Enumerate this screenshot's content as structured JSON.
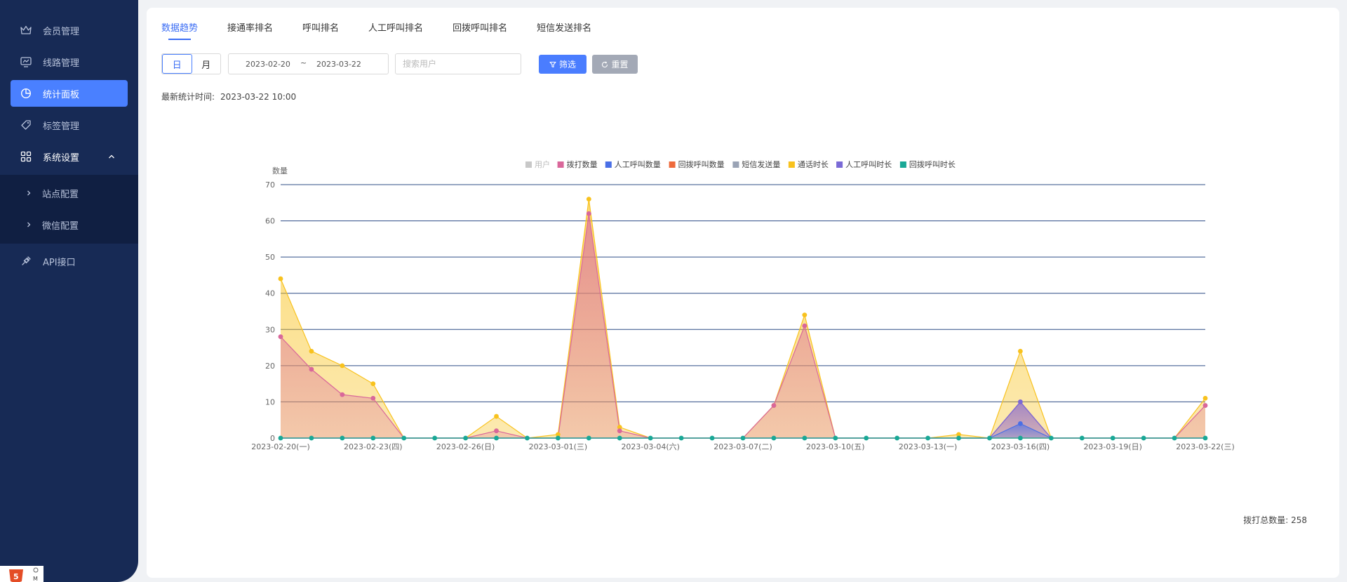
{
  "sidebar": {
    "items": [
      {
        "label": "会员管理",
        "icon": "crown-icon"
      },
      {
        "label": "线路管理",
        "icon": "route-icon"
      },
      {
        "label": "统计面板",
        "icon": "pie-chart-icon",
        "active": true
      },
      {
        "label": "标签管理",
        "icon": "tag-icon"
      },
      {
        "label": "系统设置",
        "icon": "grid-icon",
        "expanded": true
      },
      {
        "label": "API接口",
        "icon": "plug-icon"
      }
    ],
    "submenu": [
      {
        "label": "站点配置"
      },
      {
        "label": "微信配置"
      }
    ]
  },
  "tabs": [
    {
      "label": "数据趋势",
      "active": true
    },
    {
      "label": "接通率排名"
    },
    {
      "label": "呼叫排名"
    },
    {
      "label": "人工呼叫排名"
    },
    {
      "label": "回拨呼叫排名"
    },
    {
      "label": "短信发送排名"
    }
  ],
  "toolbar": {
    "seg_day": "日",
    "seg_month": "月",
    "date_start": "2023-02-20",
    "date_sep": "~",
    "date_end": "2023-03-22",
    "search_placeholder": "搜索用户",
    "filter_label": "筛选",
    "reset_label": "重置"
  },
  "stat_time": {
    "label": "最新统计时间:",
    "value": "2023-03-22 10:00"
  },
  "total": "拨打总数量: 258",
  "colors": {
    "accent": "#4a80ff",
    "sidebar_bg": "#172a55"
  },
  "chart_data": {
    "type": "area",
    "ylabel": "数量",
    "ylim": [
      0,
      70
    ],
    "yticks": [
      0,
      10,
      20,
      30,
      40,
      50,
      60,
      70
    ],
    "grid": true,
    "legend_position": "top",
    "x": [
      "2023-02-20(一)",
      "2023-02-21(二)",
      "2023-02-22(三)",
      "2023-02-23(四)",
      "2023-02-24(五)",
      "2023-02-25(六)",
      "2023-02-26(日)",
      "2023-02-27(一)",
      "2023-02-28(二)",
      "2023-03-01(三)",
      "2023-03-02(四)",
      "2023-03-03(五)",
      "2023-03-04(六)",
      "2023-03-05(日)",
      "2023-03-06(一)",
      "2023-03-07(二)",
      "2023-03-08(三)",
      "2023-03-09(四)",
      "2023-03-10(五)",
      "2023-03-11(六)",
      "2023-03-12(日)",
      "2023-03-13(一)",
      "2023-03-14(二)",
      "2023-03-15(三)",
      "2023-03-16(四)",
      "2023-03-17(五)",
      "2023-03-18(六)",
      "2023-03-19(日)",
      "2023-03-20(一)",
      "2023-03-21(二)",
      "2023-03-22(三)"
    ],
    "xtick_labels": [
      "2023-02-20(一)",
      "2023-02-23(四)",
      "2023-02-26(日)",
      "2023-03-01(三)",
      "2023-03-04(六)",
      "2023-03-07(二)",
      "2023-03-10(五)",
      "2023-03-13(一)",
      "2023-03-16(四)",
      "2023-03-19(日)",
      "2023-03-22(三)"
    ],
    "series": [
      {
        "name": "用户",
        "color": "#c8c8c8",
        "disabled": true,
        "values": []
      },
      {
        "name": "拨打数量",
        "color": "#d9679a",
        "values": [
          28,
          19,
          12,
          11,
          0,
          0,
          0,
          2,
          0,
          0,
          62,
          2,
          0,
          0,
          0,
          0,
          9,
          31,
          0,
          0,
          0,
          0,
          0,
          0,
          10,
          0,
          0,
          0,
          0,
          0,
          9
        ]
      },
      {
        "name": "人工呼叫数量",
        "color": "#4a6fe6",
        "values": [
          0,
          0,
          0,
          0,
          0,
          0,
          0,
          0,
          0,
          0,
          0,
          0,
          0,
          0,
          0,
          0,
          0,
          0,
          0,
          0,
          0,
          0,
          0,
          0,
          4,
          0,
          0,
          0,
          0,
          0,
          0
        ]
      },
      {
        "name": "回拨呼叫数量",
        "color": "#ee6a3c",
        "values": [
          0,
          0,
          0,
          0,
          0,
          0,
          0,
          0,
          0,
          0,
          0,
          0,
          0,
          0,
          0,
          0,
          0,
          0,
          0,
          0,
          0,
          0,
          0,
          0,
          0,
          0,
          0,
          0,
          0,
          0,
          0
        ]
      },
      {
        "name": "短信发送量",
        "color": "#9aa3b5",
        "values": [
          0,
          0,
          0,
          0,
          0,
          0,
          0,
          0,
          0,
          0,
          0,
          0,
          0,
          0,
          0,
          0,
          0,
          0,
          0,
          0,
          0,
          0,
          0,
          0,
          0,
          0,
          0,
          0,
          0,
          0,
          0
        ]
      },
      {
        "name": "通话时长",
        "color": "#f8c21e",
        "values": [
          44,
          24,
          20,
          15,
          0,
          0,
          0,
          6,
          0,
          1,
          66,
          3,
          0,
          0,
          0,
          0,
          9,
          34,
          0,
          0,
          0,
          0,
          1,
          0,
          24,
          0,
          0,
          0,
          0,
          0,
          11
        ]
      },
      {
        "name": "人工呼叫时长",
        "color": "#7a6ad6",
        "values": [
          0,
          0,
          0,
          0,
          0,
          0,
          0,
          0,
          0,
          0,
          0,
          0,
          0,
          0,
          0,
          0,
          0,
          0,
          0,
          0,
          0,
          0,
          0,
          0,
          10,
          0,
          0,
          0,
          0,
          0,
          0
        ]
      },
      {
        "name": "回拨呼叫时长",
        "color": "#19a896",
        "values": [
          0,
          0,
          0,
          0,
          0,
          0,
          0,
          0,
          0,
          0,
          0,
          0,
          0,
          0,
          0,
          0,
          0,
          0,
          0,
          0,
          0,
          0,
          0,
          0,
          0,
          0,
          0,
          0,
          0,
          0,
          0
        ]
      }
    ]
  }
}
